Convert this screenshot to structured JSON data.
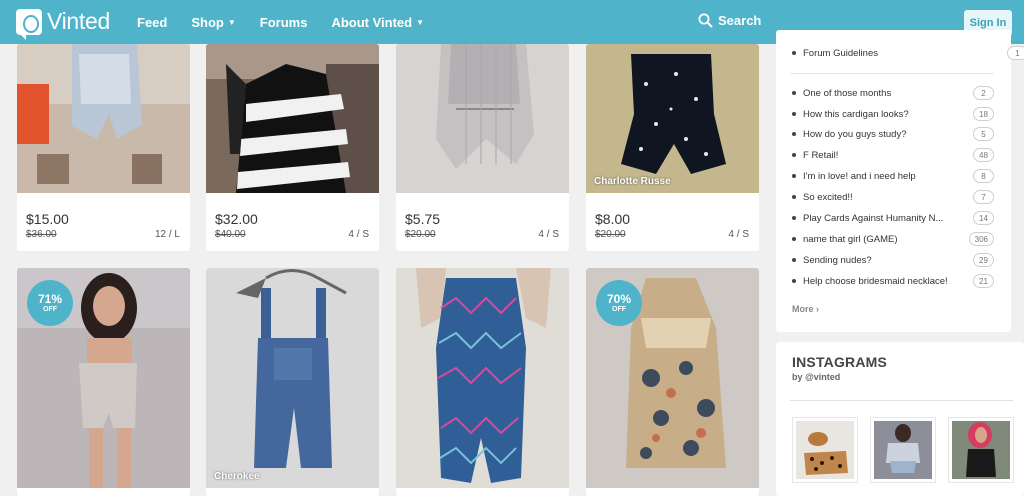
{
  "brand": {
    "name": "Vinted"
  },
  "nav": {
    "feed": "Feed",
    "shop": "Shop",
    "forums": "Forums",
    "about": "About Vinted"
  },
  "search": {
    "label": "Search"
  },
  "auth": {
    "signin": "Sign In"
  },
  "items": [
    {
      "price": "$15.00",
      "old_price": "$36.00",
      "size": "12 / L"
    },
    {
      "price": "$32.00",
      "old_price": "$40.00",
      "size": "4 / S"
    },
    {
      "price": "$5.75",
      "old_price": "$20.00",
      "size": "4 / S"
    },
    {
      "price": "$8.00",
      "old_price": "$20.00",
      "size": "4 / S",
      "brand": "Charlotte Russe"
    },
    {
      "discount": "71%",
      "off": "OFF"
    },
    {
      "brand": "Cherokee"
    },
    {},
    {
      "discount": "70%",
      "off": "OFF"
    }
  ],
  "forum": {
    "pinned": {
      "title": "Forum Guidelines",
      "count": "1"
    },
    "topics": [
      {
        "title": "One of those months",
        "count": "2"
      },
      {
        "title": "How this cardigan looks?",
        "count": "18"
      },
      {
        "title": "How do you guys study?",
        "count": "5"
      },
      {
        "title": "F Retail!",
        "count": "48"
      },
      {
        "title": "I'm in love! and i need help",
        "count": "8"
      },
      {
        "title": "So excited!!",
        "count": "7"
      },
      {
        "title": "Play Cards Against Humanity N...",
        "count": "14"
      },
      {
        "title": "name that girl (GAME)",
        "count": "306"
      },
      {
        "title": "Sending nudes?",
        "count": "29"
      },
      {
        "title": "Help choose bridesmaid necklace!",
        "count": "21"
      }
    ],
    "more": "More"
  },
  "instagram": {
    "title": "INSTAGRAMS",
    "by": "by @vinted"
  },
  "colors": {
    "header": "#4fb4c9",
    "background": "#f0f0f0",
    "badge": "#4fb4c9"
  }
}
